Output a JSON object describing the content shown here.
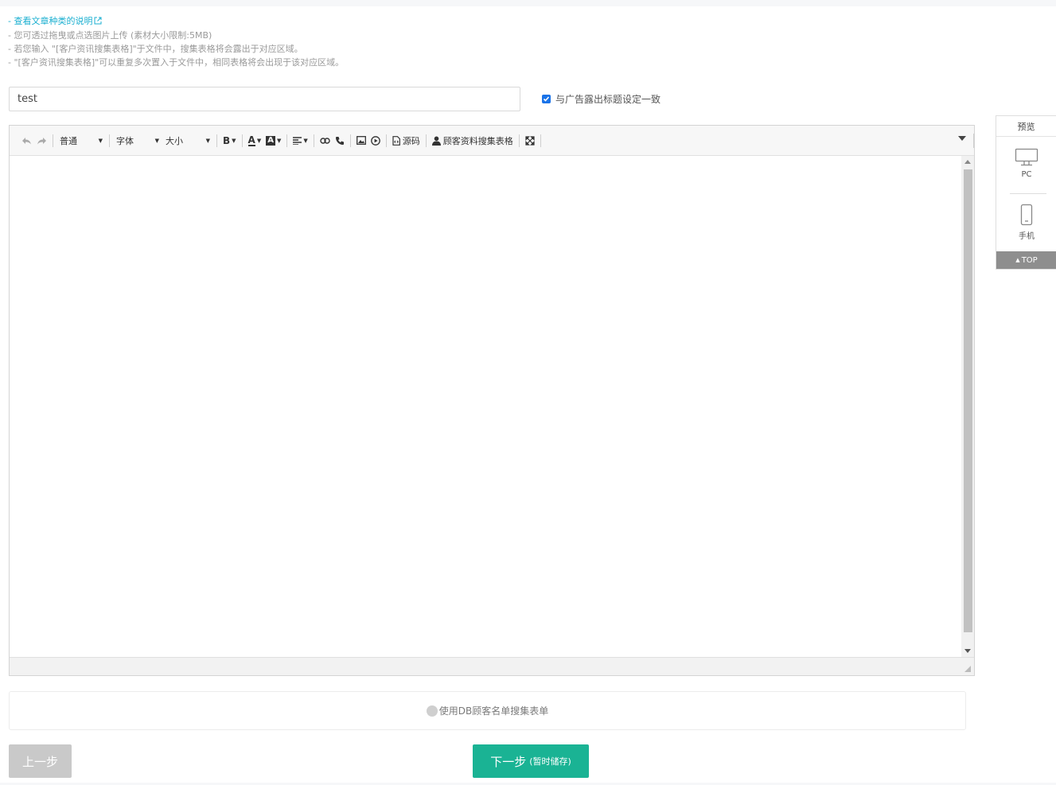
{
  "notes": {
    "link": "- 查看文章种类的说明",
    "line1": "- 您可透过拖曳或点选图片上传 (素材大小限制:5MB)",
    "line2": "- 若您输入 \"[客户资讯搜集表格]\"于文件中，搜集表格将会露出于对应区域。",
    "line3": "- \"[客户资讯搜集表格]\"可以重复多次置入于文件中，相同表格将会出现于该对应区域。"
  },
  "title_input": {
    "value": "test"
  },
  "sync_checkbox": {
    "label": "与广告露出标题设定一致",
    "checked": true
  },
  "toolbar": {
    "format": "普通",
    "font": "字体",
    "size": "大小",
    "source": "源码",
    "customer_form": "顾客资料搜集表格"
  },
  "form_toggle": {
    "label": "使用DB顾客名单搜集表单"
  },
  "buttons": {
    "prev": "上一步",
    "next": "下一步",
    "next_sub": "(暂时储存)"
  },
  "preview": {
    "title": "预览",
    "pc": "PC",
    "mobile": "手机",
    "top": "TOP"
  },
  "colors": {
    "primary": "#1ab394",
    "link": "#1aafd0",
    "checkbox": "#1a73e8"
  }
}
